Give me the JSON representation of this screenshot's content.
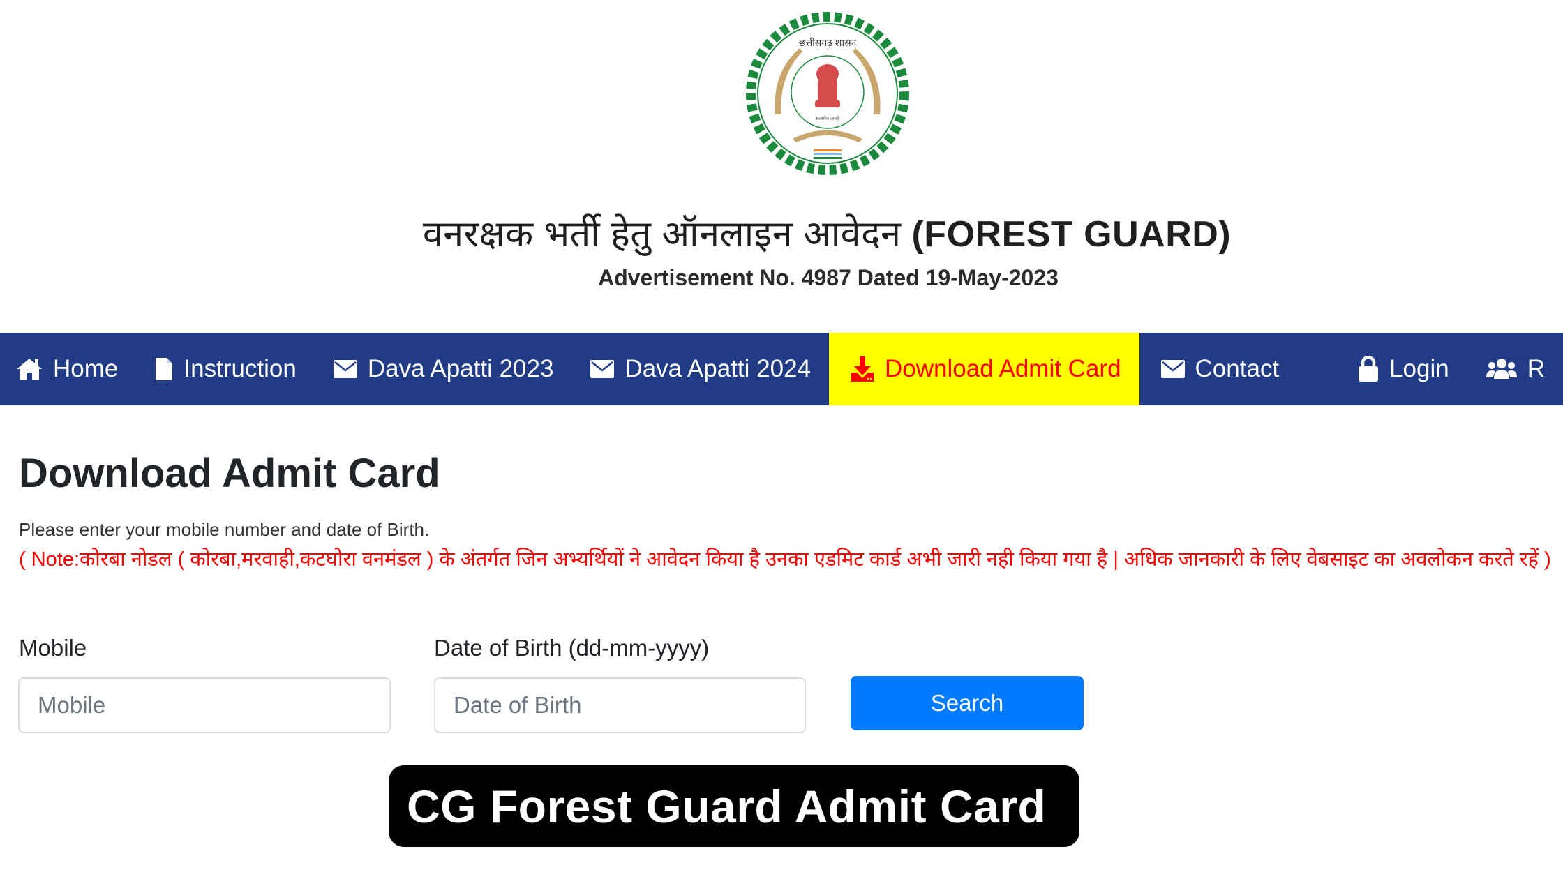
{
  "header": {
    "logo_text_top": "छत्तीसगढ़ शासन",
    "logo_motto": "सत्यमेव जयते",
    "title_hindi": "वनरक्षक भर्ती हेतु ऑनलाइन आवेदन ",
    "title_english": "(FOREST GUARD)",
    "advertisement": "Advertisement No. 4987 Dated 19-May-2023"
  },
  "nav": {
    "items": [
      {
        "label": "Home",
        "icon": "home-icon"
      },
      {
        "label": "Instruction",
        "icon": "file-icon"
      },
      {
        "label": "Dava Apatti 2023",
        "icon": "envelope-icon"
      },
      {
        "label": "Dava Apatti 2024",
        "icon": "envelope-icon"
      },
      {
        "label": "Download Admit Card",
        "icon": "download-icon",
        "active": true
      },
      {
        "label": "Contact",
        "icon": "envelope-icon"
      },
      {
        "label": "Login",
        "icon": "lock-icon"
      },
      {
        "label": "R",
        "icon": "users-icon"
      }
    ],
    "colors": {
      "background": "#213c84",
      "active_background": "#ffff00",
      "active_text": "#ff0000"
    }
  },
  "main": {
    "title": "Download Admit Card",
    "help_text": "Please enter your mobile number and date of Birth.",
    "note": "( Note:कोरबा नोडल ( कोरबा,मरवाही,कटघोरा वनमंडल ) के अंतर्गत जिन अभ्यर्थियों ने आवेदन किया है उनका एडमिट कार्ड अभी जारी नही किया गया है | अधिक जानकारी के लिए वेबसाइट का अवलोकन करते रहें )",
    "form": {
      "mobile_label": "Mobile",
      "mobile_placeholder": "Mobile",
      "mobile_value": "",
      "dob_label": "Date of Birth (dd-mm-yyyy)",
      "dob_placeholder": "Date of Birth",
      "dob_value": "",
      "search_label": "Search"
    }
  },
  "banner": {
    "text": "CG Forest Guard Admit Card"
  }
}
